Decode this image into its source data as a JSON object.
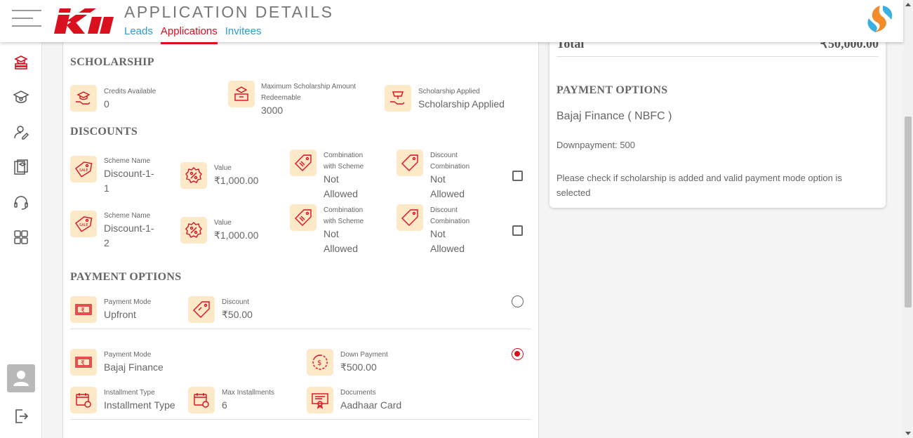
{
  "header": {
    "title": "APPLICATION DETAILS",
    "tabs": [
      {
        "label": "Leads",
        "active": false
      },
      {
        "label": "Applications",
        "active": true
      },
      {
        "label": "Invitees",
        "active": false
      }
    ],
    "logo_text": "KII"
  },
  "sidebar": {
    "items": [
      {
        "icon": "books-icon",
        "active": true
      },
      {
        "icon": "school-icon",
        "active": false
      },
      {
        "icon": "user-edit-icon",
        "active": false
      },
      {
        "icon": "course-icon",
        "active": false
      },
      {
        "icon": "headset-icon",
        "active": false
      },
      {
        "icon": "dashboard-grid-icon",
        "active": false
      }
    ],
    "logout_icon": "logout-icon"
  },
  "scholarship": {
    "title": "SCHOLARSHIP",
    "credits_label": "Credits Available",
    "credits_value": "0",
    "max_label_1": "Maximum Scholarship Amount",
    "max_label_2": "Redeemable",
    "max_value": "3000",
    "applied_label": "Scholarship Applied",
    "applied_value": "Scholarship Applied"
  },
  "discounts": {
    "title": "DISCOUNTS",
    "rows": [
      {
        "scheme_label": "Scheme Name",
        "scheme_value_1": "Discount-1-",
        "scheme_value_2": "1",
        "value_label": "Value",
        "value_value": "₹1,000.00",
        "comb_scheme_label_1": "Combination",
        "comb_scheme_label_2": "with Scheme",
        "comb_scheme_value_1": "Not",
        "comb_scheme_value_2": "Allowed",
        "disc_comb_label_1": "Discount",
        "disc_comb_label_2": "Combination",
        "disc_comb_value_1": "Not",
        "disc_comb_value_2": "Allowed",
        "checked": false
      },
      {
        "scheme_label": "Scheme Name",
        "scheme_value_1": "Discount-1-",
        "scheme_value_2": "2",
        "value_label": "Value",
        "value_value": "₹1,000.00",
        "comb_scheme_label_1": "Combination",
        "comb_scheme_label_2": "with Scheme",
        "comb_scheme_value_1": "Not",
        "comb_scheme_value_2": "Allowed",
        "disc_comb_label_1": "Discount",
        "disc_comb_label_2": "Combination",
        "disc_comb_value_1": "Not",
        "disc_comb_value_2": "Allowed",
        "checked": false
      }
    ]
  },
  "payment_options": {
    "title": "PAYMENT OPTIONS",
    "upfront": {
      "mode_label": "Payment Mode",
      "mode_value": "Upfront",
      "discount_label": "Discount",
      "discount_value": "₹50.00",
      "selected": false
    },
    "finance": {
      "mode_label": "Payment Mode",
      "mode_value": "Bajaj Finance",
      "down_label": "Down Payment",
      "down_value": "₹500.00",
      "inst_type_label": "Installment Type",
      "inst_type_value": "Installment Type",
      "max_inst_label": "Max Installments",
      "max_inst_value": "6",
      "docs_label": "Documents",
      "docs_value": "Aadhaar Card",
      "selected": true
    }
  },
  "summary": {
    "total_label": "Total",
    "total_value": "₹50,000.00",
    "payment_title": "PAYMENT OPTIONS",
    "provider": "Bajaj Finance ( NBFC )",
    "downpayment": "Downpayment: 500",
    "note_1": "Please check if scholarship is added and valid payment mode option is",
    "note_2": "selected"
  },
  "colors": {
    "accent": "#d9101e",
    "link": "#2b9bd6",
    "icon_bg": "#fde8c8"
  }
}
